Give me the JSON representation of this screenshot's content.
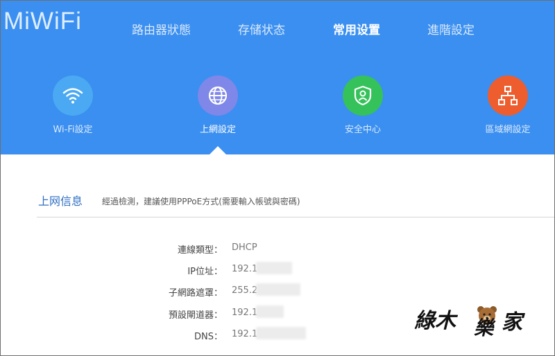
{
  "header": {
    "logo": "MiWiFi",
    "nav": [
      {
        "label": "路由器狀態"
      },
      {
        "label": "存储状态"
      },
      {
        "label": "常用设置"
      },
      {
        "label": "進階設定"
      }
    ]
  },
  "tiles": [
    {
      "label": "Wi-Fi設定",
      "icon": "wifi-icon",
      "color": "#4aa9f2"
    },
    {
      "label": "上網設定",
      "icon": "globe-icon",
      "color": "#7f87e8"
    },
    {
      "label": "安全中心",
      "icon": "shield-user-icon",
      "color": "#35c25a"
    },
    {
      "label": "區域網設定",
      "icon": "network-icon",
      "color": "#ee5d2d"
    }
  ],
  "section": {
    "title": "上网信息",
    "desc": "經過檢測，建議使用PPPoE方式(需要輸入帳號與密碼)"
  },
  "info_rows": [
    {
      "label": "連線類型：",
      "value": "DHCP"
    },
    {
      "label": "IP位址：",
      "value": "192.1"
    },
    {
      "label": "子網路遮罩：",
      "value": "255.2"
    },
    {
      "label": "預設閘道器：",
      "value": "192.1"
    },
    {
      "label": "DNS：",
      "value": "192.1"
    }
  ],
  "watermark": {
    "text": "綠木樂家"
  }
}
